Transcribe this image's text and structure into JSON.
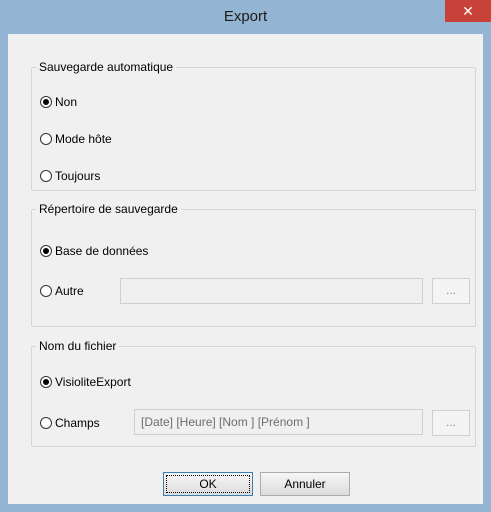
{
  "window": {
    "title": "Export",
    "close_glyph": "✕"
  },
  "auto_save": {
    "legend": "Sauvegarde automatique",
    "options": [
      "Non",
      "Mode hôte",
      "Toujours"
    ],
    "selected": "Non"
  },
  "save_dir": {
    "legend": "Répertoire de sauvegarde",
    "options": [
      "Base de données",
      "Autre"
    ],
    "selected": "Base de données",
    "path_value": "",
    "browse_label": "..."
  },
  "file_name": {
    "legend": "Nom du fichier",
    "options": [
      "VisioliteExport",
      "Champs"
    ],
    "selected": "VisioliteExport",
    "fields_value": "[Date] [Heure] [Nom ] [Prénom ]",
    "browse_label": "..."
  },
  "buttons": {
    "ok": "OK",
    "cancel": "Annuler"
  },
  "colors": {
    "title_bar": "#93b4d2",
    "close_button": "#c94239",
    "body": "#f0f0f0"
  }
}
